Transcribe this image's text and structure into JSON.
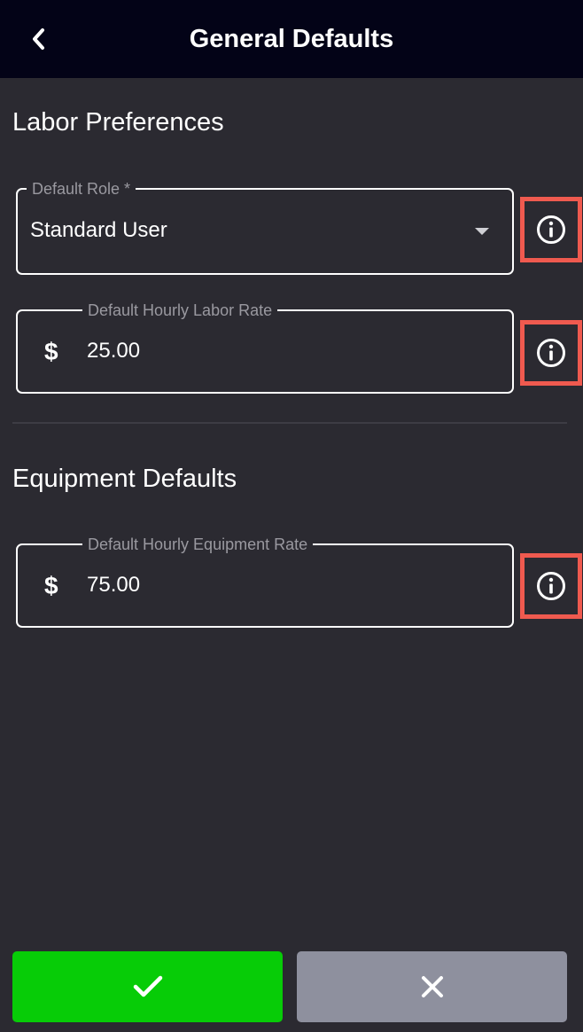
{
  "header": {
    "title": "General Defaults",
    "back_icon": "chevron-left-icon"
  },
  "labor": {
    "section_title": "Labor Preferences",
    "default_role": {
      "label": "Default Role *",
      "value": "Standard User"
    },
    "hourly_rate": {
      "label": "Default Hourly Labor Rate",
      "currency": "$",
      "value": "25.00"
    }
  },
  "equipment": {
    "section_title": "Equipment Defaults",
    "hourly_rate": {
      "label": "Default Hourly Equipment Rate",
      "currency": "$",
      "value": "75.00"
    }
  },
  "actions": {
    "confirm_icon": "checkmark-icon",
    "cancel_icon": "close-icon"
  },
  "colors": {
    "background": "#2b2a31",
    "header": "#030317",
    "confirm": "#07cc07",
    "cancel": "#8e909e",
    "highlight": "#ef5a4f"
  }
}
